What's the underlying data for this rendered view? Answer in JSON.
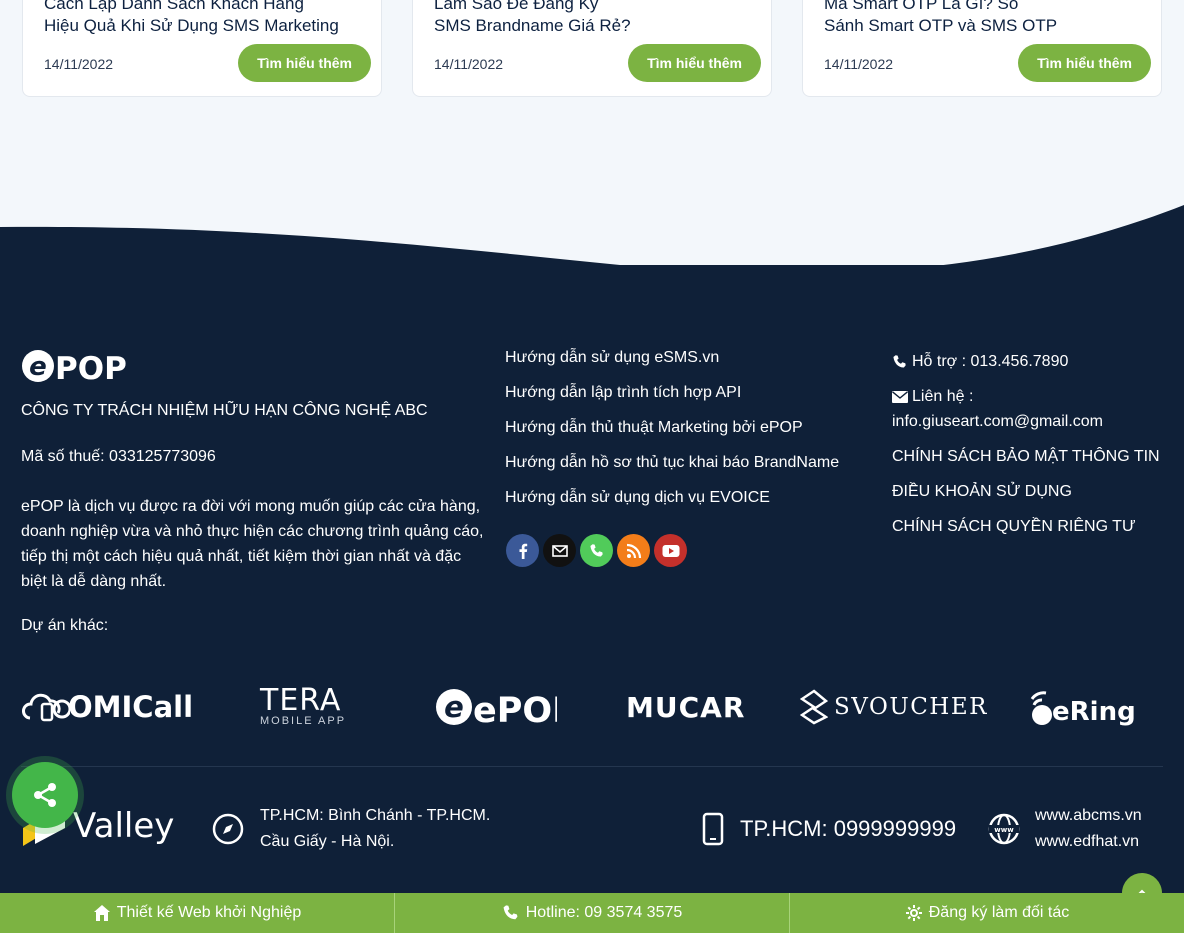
{
  "cards": [
    {
      "title_line1": "Cách Lập Danh Sách Khách Hàng",
      "title_line2": "Hiệu Quả Khi Sử Dụng SMS Marketing",
      "date": "14/11/2022",
      "button": "Tìm hiểu thêm"
    },
    {
      "title_line1": "Làm Sao Để Đăng Ký",
      "title_line2": "SMS Brandname Giá Rẻ?",
      "date": "14/11/2022",
      "button": "Tìm hiểu thêm"
    },
    {
      "title_line1": "Mã Smart OTP Là Gì? So",
      "title_line2": "Sánh Smart OTP và SMS OTP",
      "date": "14/11/2022",
      "button": "Tìm hiểu thêm"
    }
  ],
  "footer": {
    "logo_text": "ePOP",
    "company": "CÔNG TY TRÁCH NHIỆM HỮU HẠN CÔNG NGHỆ ABC",
    "tax": "Mã số thuế: 033125773096",
    "description": "ePOP là dịch vụ được ra đời với mong muốn giúp các cửa hàng, doanh nghiệp vừa và nhỏ thực hiện các chương trình quảng cáo, tiếp thị một cách hiệu quả nhất, tiết kiệm thời gian nhất và đặc biệt là dễ dàng nhất.",
    "other_projects": "Dự án khác:",
    "links": [
      "Hướng dẫn sử dụng eSMS.vn",
      "Hướng dẫn lập trình tích hợp API",
      "Hướng dẫn thủ thuật Marketing bởi ePOP",
      "Hướng dẫn hồ sơ thủ tục khai báo BrandName",
      "Hướng dẫn sử dụng dịch vụ EVOICE"
    ],
    "support": "Hỗ trợ : 013.456.7890",
    "contact_label": "Liên hệ :",
    "contact_email": "info.giuseart.com@gmail.com",
    "policy_links": [
      "CHÍNH SÁCH BẢO MẬT THÔNG TIN",
      "ĐIỀU KHOẢN SỬ DỤNG",
      "CHÍNH SÁCH QUYỀN RIÊNG TƯ"
    ],
    "partners": [
      "OMICall",
      "TERA",
      "MOBILE APP",
      "ePOP",
      "MUCAR",
      "SVOUCHER",
      "eRing"
    ],
    "valley_logo": "Valley",
    "address_line1": "TP.HCM: Bình Chánh - TP.HCM.",
    "address_line2": "Cầu Giấy - Hà Nội.",
    "phone": "TP.HCM: 0999999999",
    "web1": "www.abcms.vn",
    "web2": "www.edfhat.vn"
  },
  "bottom_bar": {
    "item1": "Thiết kế Web khởi Nghiệp",
    "item2": "Hotline: 09 3574 3575",
    "item3": "Đăng ký làm đối tác"
  },
  "colors": {
    "navy": "#0f2038",
    "green": "#7cb342",
    "share_green": "#43b649"
  }
}
